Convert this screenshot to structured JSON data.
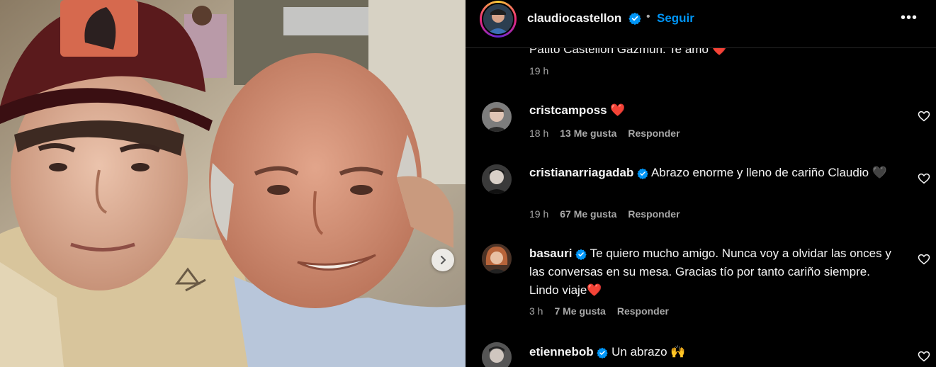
{
  "post": {
    "author": "claudiocastellon",
    "follow_label": "Seguir",
    "separator": "•",
    "more_label": "•••"
  },
  "partial_comment": {
    "text": "Patito Castellón Gazmuri. Te amo ",
    "emoji": "❤️",
    "time": "19 h"
  },
  "comments": [
    {
      "username": "cristcamposs",
      "verified": false,
      "text": "",
      "emoji": "❤️",
      "time": "18 h",
      "likes": "13 Me gusta",
      "reply": "Responder"
    },
    {
      "username": "cristianarriagadab",
      "verified": true,
      "text": "Abrazo enorme y lleno de cariño Claudio",
      "emoji": "🖤",
      "time": "19 h",
      "likes": "67 Me gusta",
      "reply": "Responder"
    },
    {
      "username": "basauri",
      "verified": true,
      "text": "Te quiero mucho amigo. Nunca voy a olvidar las onces y las conversas en su mesa. Gracias tío por tanto cariño siempre. Lindo viaje",
      "emoji": "❤️",
      "time": "3 h",
      "likes": "7 Me gusta",
      "reply": "Responder"
    },
    {
      "username": "etiennebob",
      "verified": true,
      "text": "Un abrazo",
      "emoji": "🙌",
      "time": "",
      "likes": "",
      "reply": ""
    }
  ],
  "colors": {
    "background": "#000000",
    "text": "#f5f5f5",
    "muted": "#a8a8a8",
    "accent": "#0095f6",
    "heart": "#ff3040",
    "divider": "#262626"
  },
  "icons": {
    "next": "chevron-right-icon",
    "verified": "verified-badge-icon",
    "like": "heart-outline-icon",
    "more": "more-options-icon"
  }
}
